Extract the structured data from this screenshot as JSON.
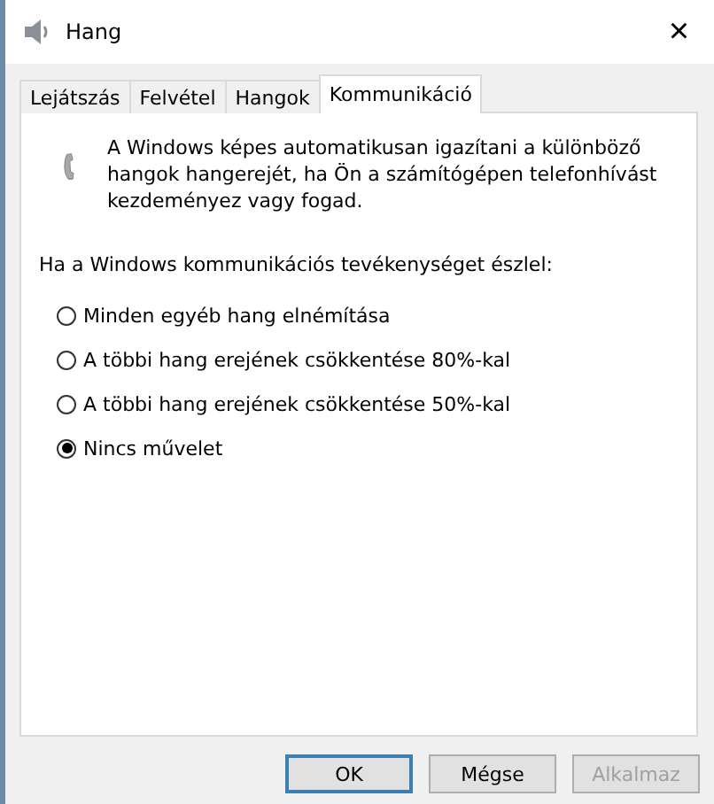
{
  "window": {
    "title": "Hang",
    "close": "×"
  },
  "tabs": [
    {
      "label": "Lejátszás",
      "selected": false
    },
    {
      "label": "Felvétel",
      "selected": false
    },
    {
      "label": "Hangok",
      "selected": false
    },
    {
      "label": "Kommunikáció",
      "selected": true
    }
  ],
  "description": "A Windows képes automatikusan igazítani a különböző hangok hangerejét, ha Ön a számítógépen telefonhívást kezdeményez vagy fogad.",
  "prompt": "Ha a Windows kommunikációs tevékenységet észlel:",
  "options": [
    {
      "label": "Minden egyéb hang elnémítása",
      "selected": false
    },
    {
      "label": "A többi hang erejének csökkentése 80%-kal",
      "selected": false
    },
    {
      "label": "A többi hang erejének csökkentése 50%-kal",
      "selected": false
    },
    {
      "label": "Nincs művelet",
      "selected": true
    }
  ],
  "buttons": [
    {
      "label": "OK",
      "kind": "default",
      "disabled": false
    },
    {
      "label": "Mégse",
      "kind": "normal",
      "disabled": false
    },
    {
      "label": "Alkalmaz",
      "kind": "normal",
      "disabled": true
    }
  ]
}
